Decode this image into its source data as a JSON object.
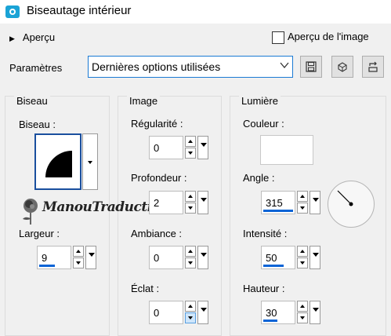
{
  "window": {
    "title": "Biseautage intérieur"
  },
  "preview": {
    "label": "Aperçu",
    "image_preview_label": "Aperçu de l'image",
    "image_preview_checked": false
  },
  "presets": {
    "label": "Paramètres",
    "selected": "Dernières options utilisées"
  },
  "toolbar": {
    "icons": [
      "save-icon",
      "reset-icon",
      "manage-presets-icon"
    ]
  },
  "bevel": {
    "group_title": "Biseau",
    "shape_label": "Biseau :",
    "width_label": "Largeur :",
    "width_value": "9"
  },
  "image": {
    "group_title": "Image",
    "smoothness_label": "Régularité :",
    "smoothness_value": "0",
    "depth_label": "Profondeur :",
    "depth_value": "2",
    "ambience_label": "Ambiance :",
    "ambience_value": "0",
    "shininess_label": "Éclat :",
    "shininess_value": "0"
  },
  "light": {
    "group_title": "Lumière",
    "color_label": "Couleur :",
    "color_value": "#ffffff",
    "angle_label": "Angle :",
    "angle_value": "315",
    "intensity_label": "Intensité :",
    "intensity_value": "50",
    "elevation_label": "Hauteur :",
    "elevation_value": "30"
  },
  "watermark": {
    "text": "ManouTraductions"
  },
  "colors": {
    "accent": "#0a64d6",
    "app_icon": "#1aa3d6",
    "focus_border": "#1a7ad4"
  }
}
